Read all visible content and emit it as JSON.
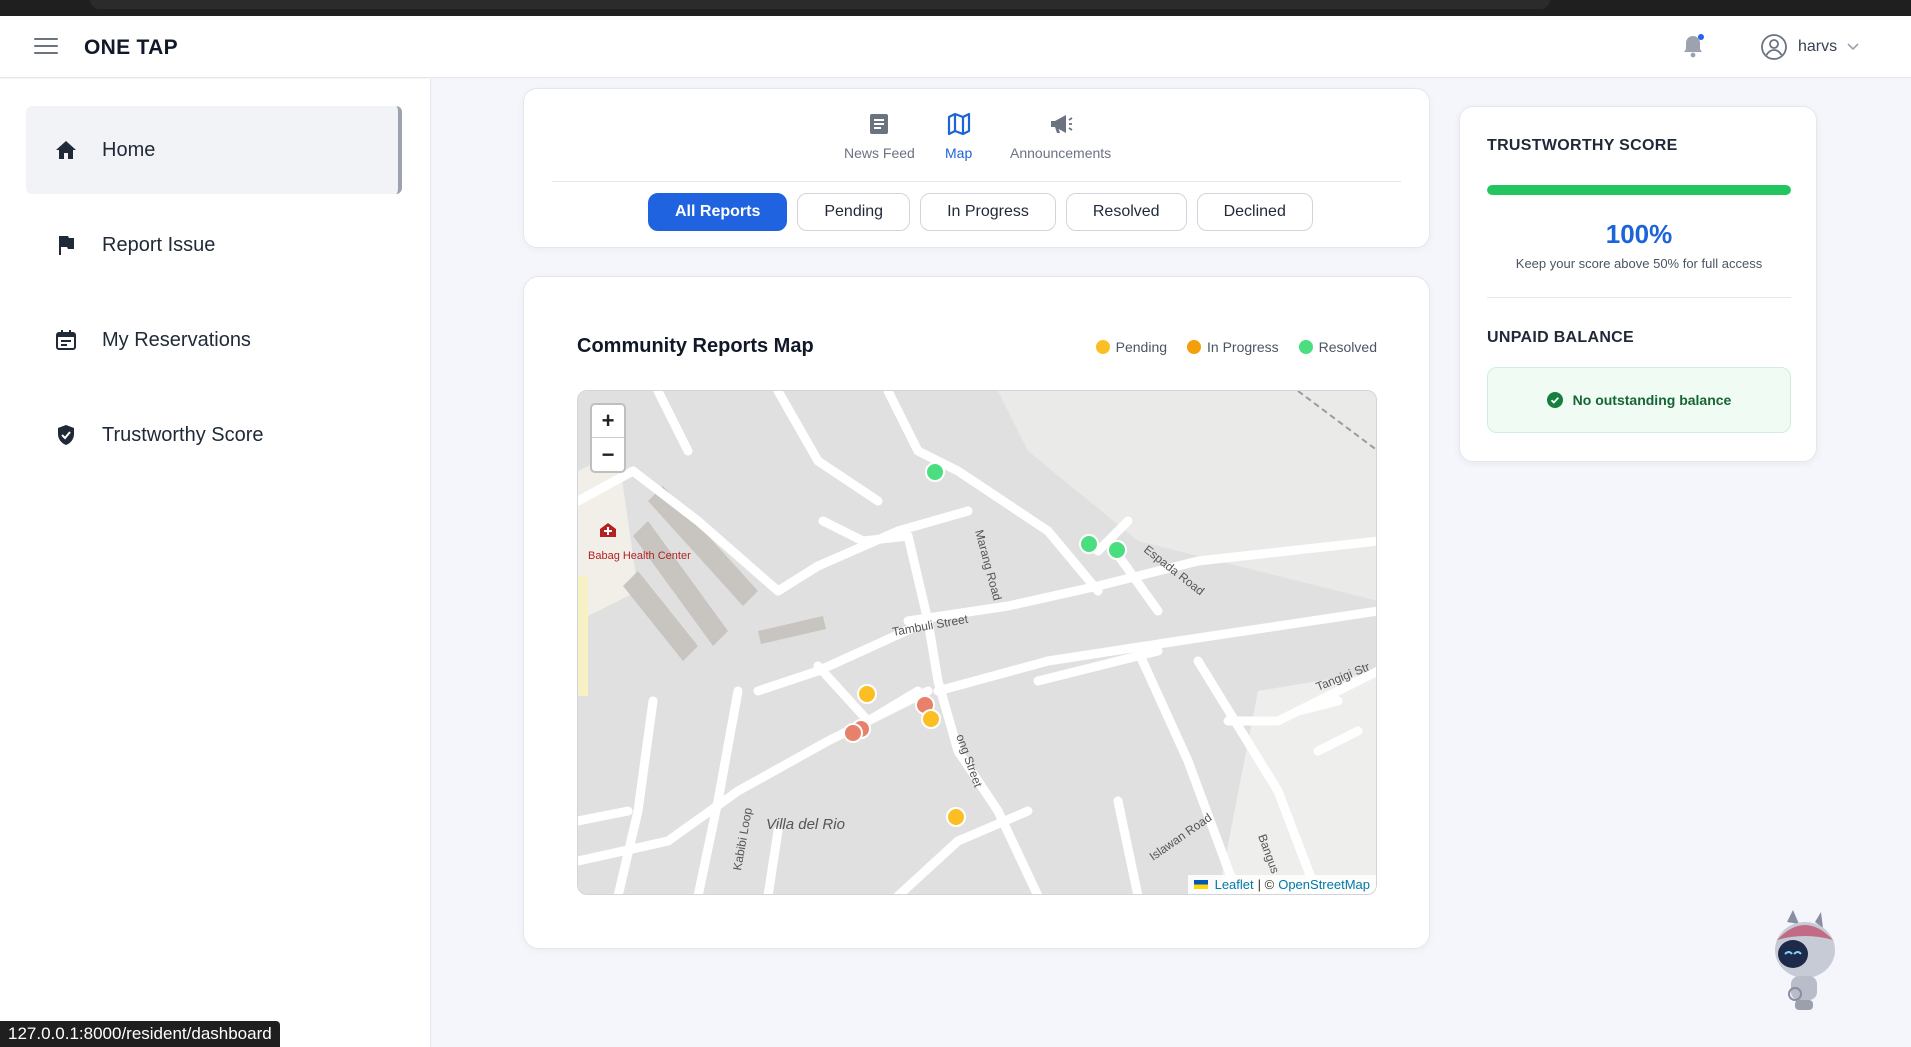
{
  "app": {
    "brand": "ONE TAP"
  },
  "user": {
    "name": "harvs"
  },
  "sidebar": {
    "items": [
      {
        "label": "Home",
        "icon": "home-icon",
        "active": true
      },
      {
        "label": "Report Issue",
        "icon": "flag-icon",
        "active": false
      },
      {
        "label": "My Reservations",
        "icon": "calendar-icon",
        "active": false
      },
      {
        "label": "Trustworthy Score",
        "icon": "shield-check-icon",
        "active": false
      }
    ]
  },
  "view_tabs": [
    {
      "label": "News Feed",
      "icon": "newspaper-icon",
      "active": false
    },
    {
      "label": "Map",
      "icon": "map-icon",
      "active": true
    },
    {
      "label": "Announcements",
      "icon": "megaphone-icon",
      "active": false
    }
  ],
  "filters": [
    {
      "label": "All Reports",
      "active": true
    },
    {
      "label": "Pending",
      "active": false
    },
    {
      "label": "In Progress",
      "active": false
    },
    {
      "label": "Resolved",
      "active": false
    },
    {
      "label": "Declined",
      "active": false
    }
  ],
  "map_card": {
    "title": "Community Reports Map",
    "legend": [
      {
        "label": "Pending",
        "color": "#fbbf24"
      },
      {
        "label": "In Progress",
        "color": "#f59e0b"
      },
      {
        "label": "Resolved",
        "color": "#4ade80"
      }
    ],
    "zoom_in": "+",
    "zoom_out": "−",
    "attribution": {
      "leaflet": "Leaflet",
      "separator": "| ©",
      "osm": "OpenStreetMap"
    },
    "labels": {
      "health_center": "Babag Health Center",
      "tambuli": "Tambuli Street",
      "marang": "Marang Road",
      "espada": "Espada Road",
      "tangigi": "Tangigi Str",
      "villa": "Villa del Rio",
      "kabibi": "Kabibi Loop",
      "islawan": "Islawan Road",
      "bangus": "Bangus",
      "ong": "ong Street"
    }
  },
  "score_card": {
    "heading": "TRUSTWORTHY SCORE",
    "score": "100%",
    "score_fraction": 1.0,
    "hint": "Keep your score above 50% for full access",
    "balance_heading": "UNPAID BALANCE",
    "balance_text": "No outstanding balance"
  },
  "status_bar": {
    "url": "127.0.0.1:8000/resident/dashboard"
  },
  "colors": {
    "accent": "#1f63e0",
    "success": "#22c55e",
    "pending": "#fbbf24",
    "declined": "#e8806a"
  }
}
